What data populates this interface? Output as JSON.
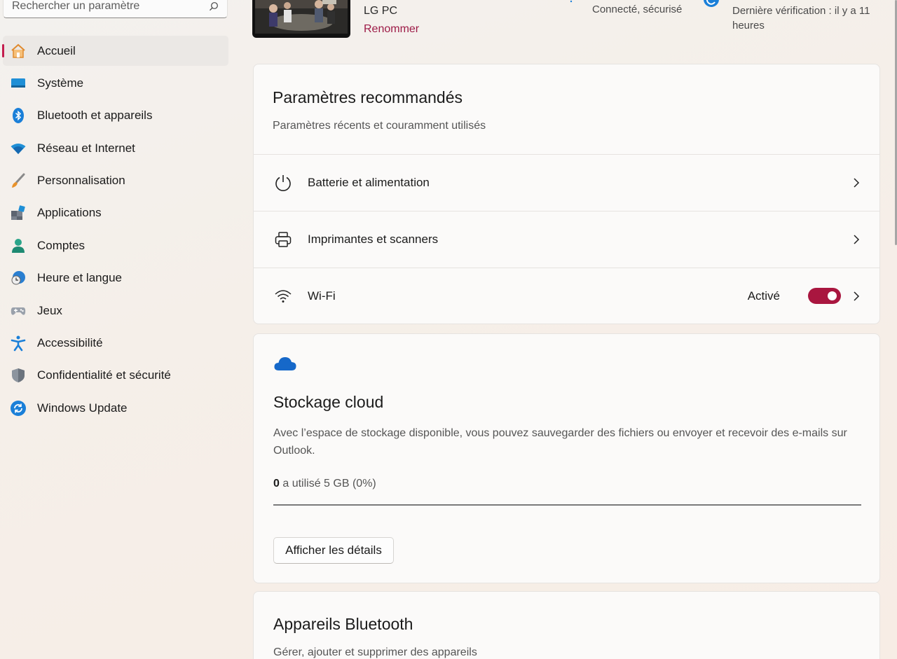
{
  "search": {
    "placeholder": "Rechercher un paramètre"
  },
  "sidebar": {
    "items": [
      {
        "label": "Accueil",
        "icon": "home-icon",
        "active": true
      },
      {
        "label": "Système",
        "icon": "system-icon"
      },
      {
        "label": "Bluetooth et appareils",
        "icon": "bluetooth-icon"
      },
      {
        "label": "Réseau et Internet",
        "icon": "wifi-icon"
      },
      {
        "label": "Personnalisation",
        "icon": "brush-icon"
      },
      {
        "label": "Applications",
        "icon": "apps-icon"
      },
      {
        "label": "Comptes",
        "icon": "account-icon"
      },
      {
        "label": "Heure et langue",
        "icon": "clock-globe-icon"
      },
      {
        "label": "Jeux",
        "icon": "gamepad-icon"
      },
      {
        "label": "Accessibilité",
        "icon": "accessibility-icon"
      },
      {
        "label": "Confidentialité et sécurité",
        "icon": "shield-icon"
      },
      {
        "label": "Windows Update",
        "icon": "update-icon"
      }
    ]
  },
  "header": {
    "pc_model": "LG PC",
    "rename_label": "Renommer",
    "network_status": "Connecté, sécurisé",
    "update_status": "Dernière vérification : il y a 11 heures"
  },
  "recommended": {
    "title": "Paramètres recommandés",
    "subtitle": "Paramètres récents et couramment utilisés",
    "rows": [
      {
        "label": "Batterie et alimentation",
        "icon": "power-icon"
      },
      {
        "label": "Imprimantes et scanners",
        "icon": "printer-icon"
      },
      {
        "label": "Wi-Fi",
        "icon": "wifi-signal-icon",
        "state": "Activé",
        "toggle_on": true
      }
    ]
  },
  "cloud": {
    "title": "Stockage cloud",
    "description": "Avec l’espace de stockage disponible, vous pouvez sauvegarder des fichiers ou envoyer et recevoir des e-mails sur Outlook.",
    "used_value": "0",
    "usage_text": "a utilisé 5 GB (0%)",
    "usage_fraction": 0,
    "button_label": "Afficher les détails"
  },
  "bluetooth": {
    "title": "Appareils Bluetooth",
    "subtitle": "Gérer, ajouter et supprimer des appareils"
  },
  "colors": {
    "accent": "#c41d4e",
    "toggle_on": "#a9163f",
    "link": "#9d1b47"
  }
}
